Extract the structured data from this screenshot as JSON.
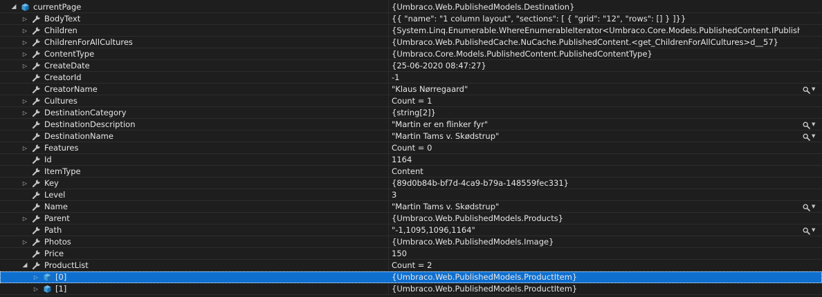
{
  "rows": [
    {
      "depth": 0,
      "expander": "open",
      "icon": "object-icon",
      "name": "currentPage",
      "value": "{Umbraco.Web.PublishedModels.Destination}",
      "viz": false
    },
    {
      "depth": 1,
      "expander": "closed",
      "icon": "property-icon",
      "name": "BodyText",
      "value": "{{  \"name\": \"1 column layout\",  \"sections\": [    {      \"grid\": \"12\",      \"rows\": []    }  ]}}",
      "viz": false
    },
    {
      "depth": 1,
      "expander": "closed",
      "icon": "property-icon",
      "name": "Children",
      "value": "{System.Linq.Enumerable.WhereEnumerableIterator<Umbraco.Core.Models.PublishedContent.IPublishedContent>}",
      "viz": false
    },
    {
      "depth": 1,
      "expander": "closed",
      "icon": "property-icon",
      "name": "ChildrenForAllCultures",
      "value": "{Umbraco.Web.PublishedCache.NuCache.PublishedContent.<get_ChildrenForAllCultures>d__57}",
      "viz": false
    },
    {
      "depth": 1,
      "expander": "closed",
      "icon": "property-icon",
      "name": "ContentType",
      "value": "{Umbraco.Core.Models.PublishedContent.PublishedContentType}",
      "viz": false
    },
    {
      "depth": 1,
      "expander": "closed",
      "icon": "property-icon",
      "name": "CreateDate",
      "value": "{25-06-2020 08:47:27}",
      "viz": false
    },
    {
      "depth": 1,
      "expander": "none",
      "icon": "property-icon",
      "name": "CreatorId",
      "value": "-1",
      "viz": false
    },
    {
      "depth": 1,
      "expander": "none",
      "icon": "property-icon",
      "name": "CreatorName",
      "value": "\"Klaus Nørregaard\"",
      "viz": true
    },
    {
      "depth": 1,
      "expander": "closed",
      "icon": "property-icon",
      "name": "Cultures",
      "value": "Count = 1",
      "viz": false
    },
    {
      "depth": 1,
      "expander": "closed",
      "icon": "property-icon",
      "name": "DestinationCategory",
      "value": "{string[2]}",
      "viz": false
    },
    {
      "depth": 1,
      "expander": "none",
      "icon": "property-icon",
      "name": "DestinationDescription",
      "value": "\"Martin er en flinker fyr\"",
      "viz": true
    },
    {
      "depth": 1,
      "expander": "none",
      "icon": "property-icon",
      "name": "DestinationName",
      "value": "\"Martin Tams v. Skødstrup\"",
      "viz": true
    },
    {
      "depth": 1,
      "expander": "closed",
      "icon": "property-icon",
      "name": "Features",
      "value": "Count = 0",
      "viz": false
    },
    {
      "depth": 1,
      "expander": "none",
      "icon": "property-icon",
      "name": "Id",
      "value": "1164",
      "viz": false
    },
    {
      "depth": 1,
      "expander": "none",
      "icon": "property-icon",
      "name": "ItemType",
      "value": "Content",
      "viz": false
    },
    {
      "depth": 1,
      "expander": "closed",
      "icon": "property-icon",
      "name": "Key",
      "value": "{89d0b84b-bf7d-4ca9-b79a-148559fec331}",
      "viz": false
    },
    {
      "depth": 1,
      "expander": "none",
      "icon": "property-icon",
      "name": "Level",
      "value": "3",
      "viz": false
    },
    {
      "depth": 1,
      "expander": "none",
      "icon": "property-icon",
      "name": "Name",
      "value": "\"Martin Tams v. Skødstrup\"",
      "viz": true
    },
    {
      "depth": 1,
      "expander": "closed",
      "icon": "property-icon",
      "name": "Parent",
      "value": "{Umbraco.Web.PublishedModels.Products}",
      "viz": false
    },
    {
      "depth": 1,
      "expander": "none",
      "icon": "property-icon",
      "name": "Path",
      "value": "\"-1,1095,1096,1164\"",
      "viz": true
    },
    {
      "depth": 1,
      "expander": "closed",
      "icon": "property-icon",
      "name": "Photos",
      "value": "{Umbraco.Web.PublishedModels.Image}",
      "viz": false
    },
    {
      "depth": 1,
      "expander": "none",
      "icon": "property-icon",
      "name": "Price",
      "value": "150",
      "viz": false
    },
    {
      "depth": 1,
      "expander": "open",
      "icon": "property-icon",
      "name": "ProductList",
      "value": "Count = 2",
      "viz": false
    },
    {
      "depth": 2,
      "expander": "closed",
      "icon": "object-icon",
      "name": "[0]",
      "value": "{Umbraco.Web.PublishedModels.ProductItem}",
      "viz": false,
      "selected": true
    },
    {
      "depth": 2,
      "expander": "closed",
      "icon": "object-icon",
      "name": "[1]",
      "value": "{Umbraco.Web.PublishedModels.ProductItem}",
      "viz": false
    }
  ],
  "colors": {
    "background": "#1e1e1e",
    "selection": "#0e6fcf",
    "wrench": "#c5c5c5",
    "object": "#3f9bd6"
  }
}
